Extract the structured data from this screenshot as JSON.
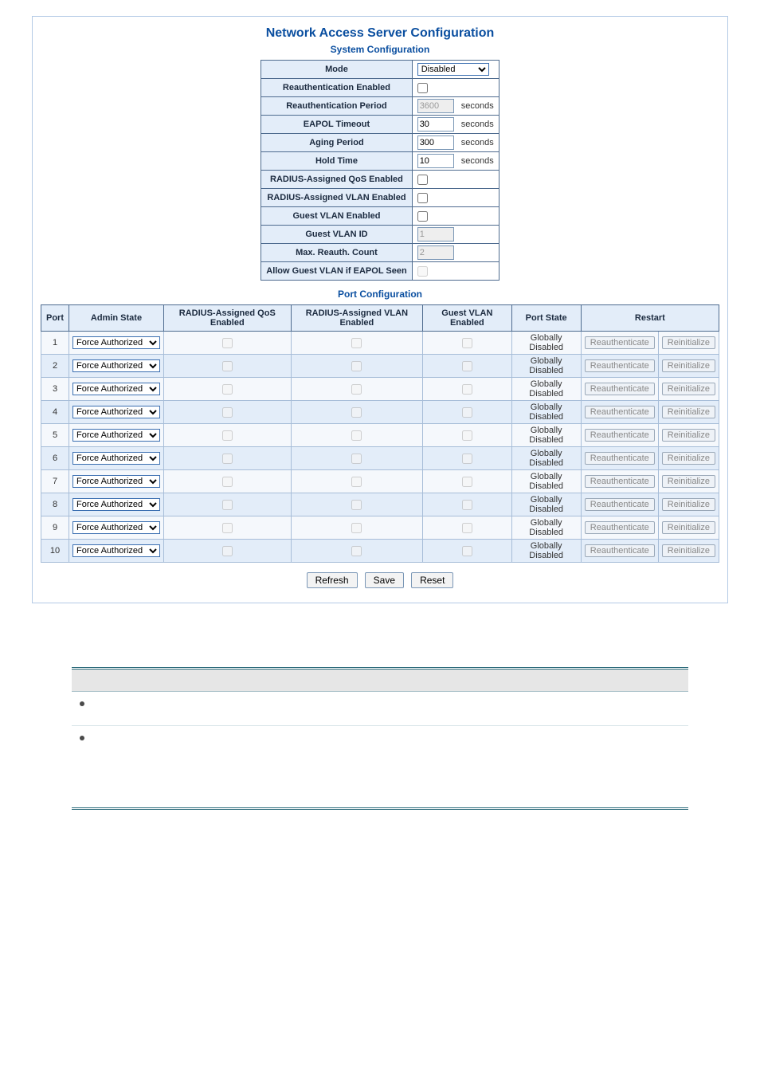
{
  "titles": {
    "main": "Network Access Server Configuration",
    "system": "System Configuration",
    "port": "Port Configuration"
  },
  "sys": {
    "mode_label": "Mode",
    "mode_value": "Disabled",
    "reauth_enabled_label": "Reauthentication Enabled",
    "reauth_period_label": "Reauthentication Period",
    "reauth_period_value": "3600",
    "eapol_timeout_label": "EAPOL Timeout",
    "eapol_timeout_value": "30",
    "aging_label": "Aging Period",
    "aging_value": "300",
    "hold_label": "Hold Time",
    "hold_value": "10",
    "unit_seconds": "seconds",
    "radius_qos_label": "RADIUS-Assigned QoS Enabled",
    "radius_vlan_label": "RADIUS-Assigned VLAN Enabled",
    "guest_vlan_enabled_label": "Guest VLAN Enabled",
    "guest_vlan_id_label": "Guest VLAN ID",
    "guest_vlan_id_value": "1",
    "max_reauth_label": "Max. Reauth. Count",
    "max_reauth_value": "2",
    "allow_guest_label": "Allow Guest VLAN if EAPOL Seen"
  },
  "port_headers": {
    "port": "Port",
    "admin_state": "Admin State",
    "qos": "RADIUS-Assigned QoS Enabled",
    "vlan": "RADIUS-Assigned VLAN Enabled",
    "guest_vlan": "Guest VLAN Enabled",
    "state": "Port State",
    "restart": "Restart"
  },
  "port_common": {
    "admin_option": "Force Authorized",
    "port_state": "Globally Disabled",
    "reauth_btn": "Reauthenticate",
    "reinit_btn": "Reinitialize"
  },
  "ports": [
    {
      "n": "1"
    },
    {
      "n": "2"
    },
    {
      "n": "3"
    },
    {
      "n": "4"
    },
    {
      "n": "5"
    },
    {
      "n": "6"
    },
    {
      "n": "7"
    },
    {
      "n": "8"
    },
    {
      "n": "9"
    },
    {
      "n": "10"
    }
  ],
  "buttons": {
    "refresh": "Refresh",
    "save": "Save",
    "reset": "Reset"
  },
  "spec": {
    "row1_left": "",
    "row2": {
      "b1": "",
      "b2": ""
    }
  }
}
